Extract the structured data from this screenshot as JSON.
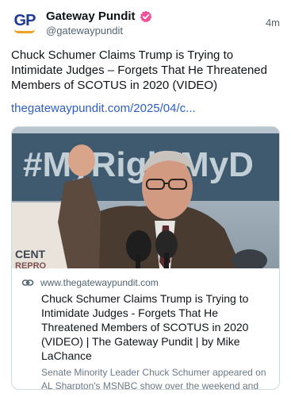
{
  "author": {
    "display_name": "Gateway Pundit",
    "handle": "@gatewaypundit",
    "avatar_text": "GP",
    "verified_icon": "verified-badge-icon"
  },
  "post": {
    "timestamp": "4m",
    "text": "Chuck Schumer Claims Trump is Trying to Intimidate Judges – Forgets That He Threatened Members of SCOTUS in 2020 (VIDEO)",
    "link_text": "thegatewaypundit.com/2025/04/c..."
  },
  "card": {
    "domain": "www.thegatewaypundit.com",
    "title": "Chuck Schumer Claims Trump is Trying to Intimidate Judges - Forgets That He Threatened Members of SCOTUS in 2020 (VIDEO) | The Gateway Pundit | by Mike LaChance",
    "description": "Senate Minority Leader Chuck Schumer appeared on AL Sharpton's MSNBC show over the weekend and claimed that Trump is trying to intimidate judges.",
    "image_banner_text": "#MyRightMyD",
    "image_sign_text": "CENT",
    "image_sign_text_2": "REPRO",
    "link_icon": "link-icon"
  },
  "colors": {
    "accent_link": "#2f5fc2",
    "verified": "#f0509a",
    "avatar_blue": "#1f3a93",
    "avatar_orange": "#f0a021",
    "secondary_text": "#536471"
  }
}
